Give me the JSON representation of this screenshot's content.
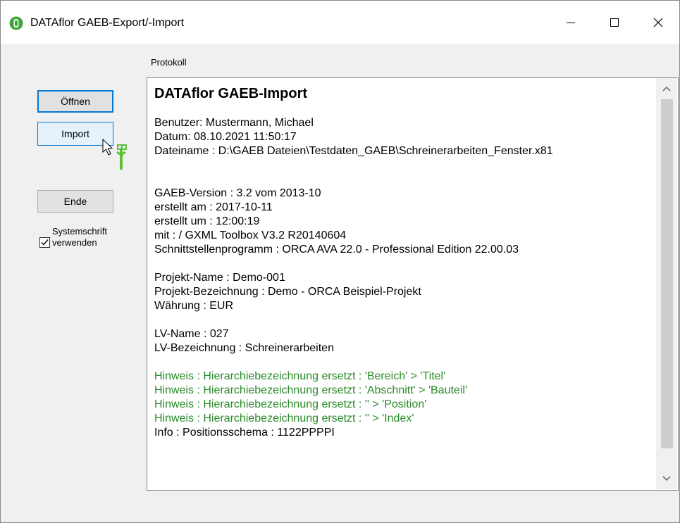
{
  "window": {
    "title": "DATAflor GAEB-Export/-Import",
    "icon": "dataflor-app-icon",
    "controls": [
      "minimize-icon",
      "maximize-icon",
      "close-icon"
    ]
  },
  "sidebar": {
    "open_label": "Öffnen",
    "import_label": "Import",
    "end_label": "Ende",
    "system_font_label_line1": "Systemschrift",
    "system_font_label_line2": "verwenden",
    "system_font_checked": true
  },
  "protocol": {
    "label": "Protokoll",
    "heading": "DATAflor GAEB-Import",
    "lines": [
      "Benutzer: Mustermann, Michael",
      "Datum: 08.10.2021 11:50:17",
      "Dateiname : D:\\GAEB Dateien\\Testdaten_GAEB\\Schreinerarbeiten_Fenster.x81",
      "",
      "",
      "GAEB-Version : 3.2 vom 2013-10",
      "erstellt am : 2017-10-11",
      "erstellt um : 12:00:19",
      "mit : / GXML Toolbox V3.2 R20140604",
      "Schnittstellenprogramm : ORCA AVA 22.0 - Professional Edition 22.00.03",
      "",
      "Projekt-Name : Demo-001",
      "Projekt-Bezeichnung : Demo - ORCA Beispiel-Projekt",
      "Währung : EUR",
      "",
      "LV-Name : 027",
      "LV-Bezeichnung : Schreinerarbeiten",
      ""
    ],
    "hints": [
      "Hinweis : Hierarchiebezeichnung ersetzt : 'Bereich' > 'Titel'",
      "Hinweis : Hierarchiebezeichnung ersetzt : 'Abschnitt' > 'Bauteil'",
      "Hinweis : Hierarchiebezeichnung ersetzt : '' > 'Position'",
      "Hinweis : Hierarchiebezeichnung ersetzt : '' > 'Index'"
    ],
    "last_line": "Info : Positionsschema : 1122PPPPI"
  },
  "colors": {
    "hint_green": "#2a8b2a",
    "focus_blue": "#0078d7",
    "app_icon_green": "#3aa63a"
  }
}
